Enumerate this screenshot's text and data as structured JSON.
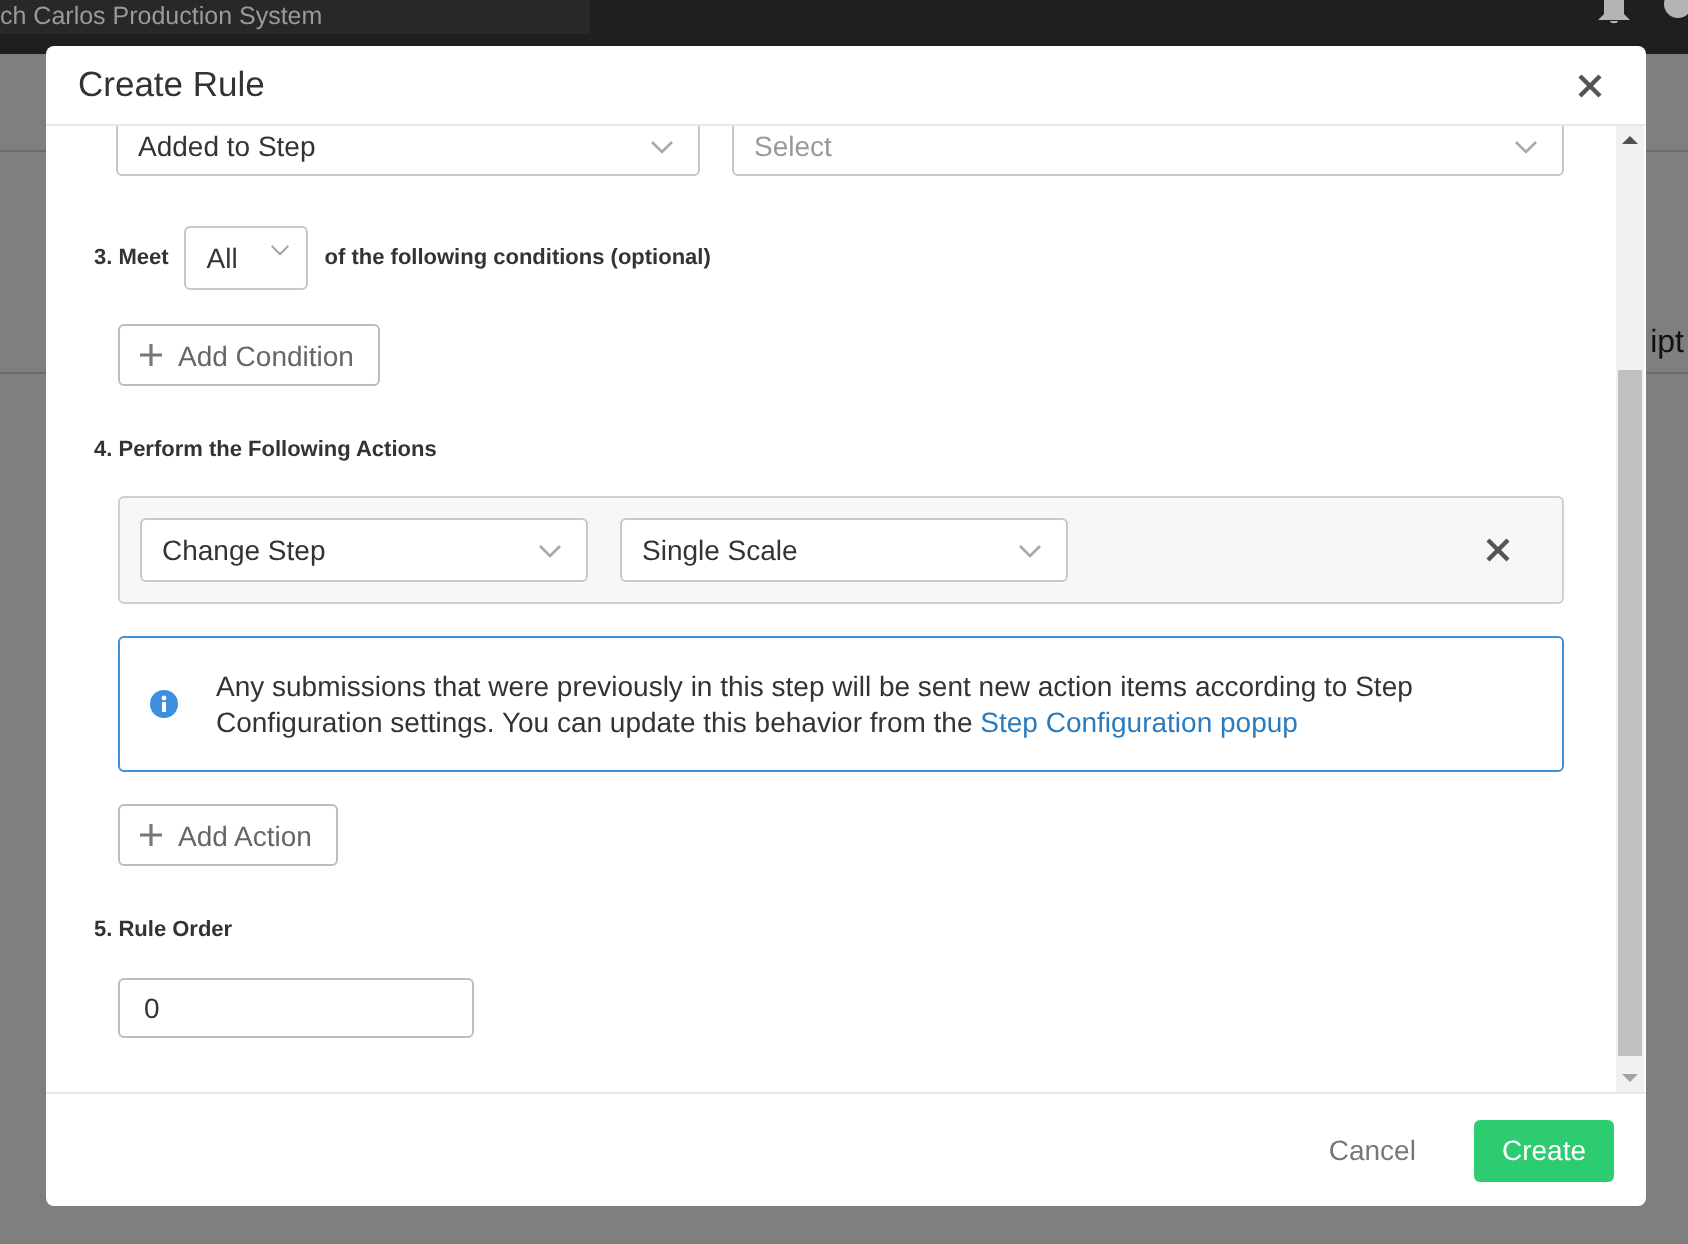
{
  "background": {
    "app_title": "ch Carlos Production System",
    "column_heading": "ipt"
  },
  "dialog": {
    "title": "Create Rule"
  },
  "trigger": {
    "event_select": {
      "value": "Added to Step"
    },
    "step_select": {
      "placeholder": "Select"
    }
  },
  "conditions": {
    "label": "3. Meet",
    "match_select": {
      "value": "All"
    },
    "label_suffix": "of the following conditions (optional)",
    "add_button": "Add Condition"
  },
  "actions": {
    "label": "4. Perform the Following Actions",
    "items": [
      {
        "action_select": {
          "value": "Change Step"
        },
        "target_select": {
          "value": "Single Scale"
        }
      }
    ],
    "notice": {
      "text": "Any submissions that were previously in this step will be sent new action items according to Step Configuration settings. You can update this behavior from the",
      "link": "Step Configuration popup"
    },
    "add_button": "Add Action"
  },
  "rule_order": {
    "label": "5. Rule Order",
    "value": "0"
  },
  "footer": {
    "buttons": [
      {
        "label": "Cancel",
        "kind": "secondary"
      },
      {
        "label": "Create",
        "kind": "primary"
      }
    ]
  }
}
